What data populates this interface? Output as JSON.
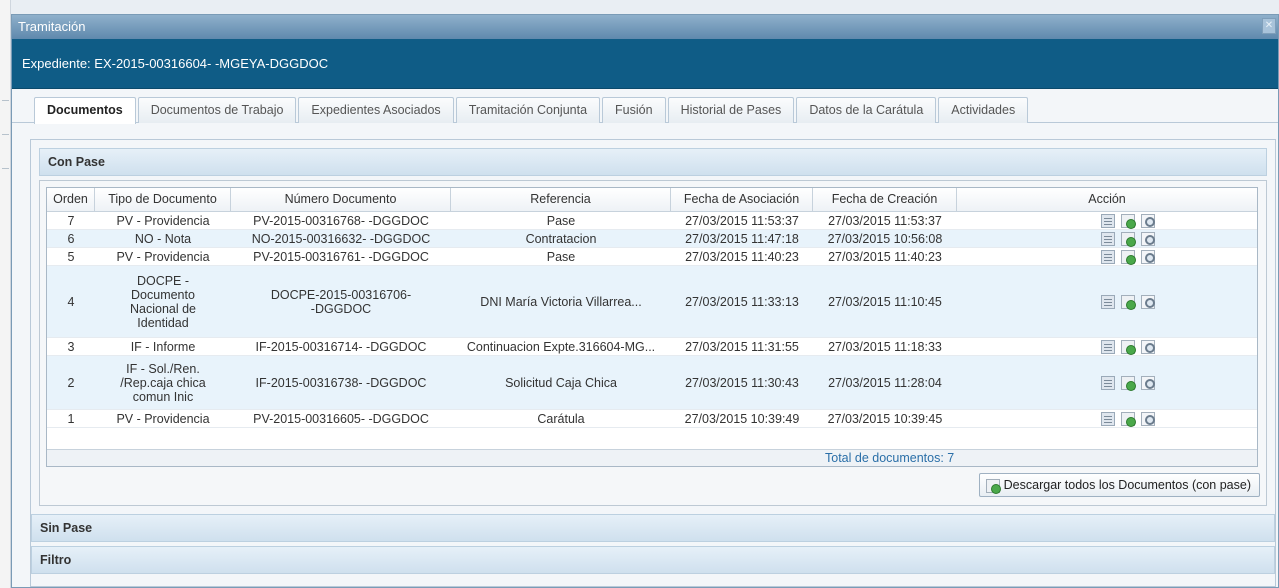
{
  "window": {
    "title": "Tramitación",
    "close_icon": "close-icon"
  },
  "expediente": {
    "label": "Expediente: EX-2015-00316604- -MGEYA-DGGDOC"
  },
  "tabs": [
    {
      "label": "Documentos",
      "active": true
    },
    {
      "label": "Documentos de Trabajo",
      "active": false
    },
    {
      "label": "Expedientes Asociados",
      "active": false
    },
    {
      "label": "Tramitación Conjunta",
      "active": false
    },
    {
      "label": "Fusión",
      "active": false
    },
    {
      "label": "Historial de Pases",
      "active": false
    },
    {
      "label": "Datos de la Carátula",
      "active": false
    },
    {
      "label": "Actividades",
      "active": false
    }
  ],
  "con_pase": {
    "title": "Con Pase",
    "columns": [
      "Orden",
      "Tipo de Documento",
      "Número Documento",
      "Referencia",
      "Fecha de Asociación",
      "Fecha de Creación",
      "Acción"
    ],
    "rows": [
      {
        "orden": "7",
        "tipo": "PV - Providencia",
        "numero": "PV-2015-00316768- -DGGDOC",
        "referencia": "Pase",
        "fecha_asoc": "27/03/2015 11:53:37",
        "fecha_creacion": "27/03/2015 11:53:37"
      },
      {
        "orden": "6",
        "tipo": "NO - Nota",
        "numero": "NO-2015-00316632- -DGGDOC",
        "referencia": "Contratacion",
        "fecha_asoc": "27/03/2015 11:47:18",
        "fecha_creacion": "27/03/2015 10:56:08"
      },
      {
        "orden": "5",
        "tipo": "PV - Providencia",
        "numero": "PV-2015-00316761- -DGGDOC",
        "referencia": "Pase",
        "fecha_asoc": "27/03/2015 11:40:23",
        "fecha_creacion": "27/03/2015 11:40:23"
      },
      {
        "orden": "4",
        "tipo": "DOCPE -\nDocumento\nNacional de\nIdentidad",
        "numero": "DOCPE-2015-00316706-\n-DGGDOC",
        "referencia": "DNI María Victoria Villarrea...",
        "fecha_asoc": "27/03/2015 11:33:13",
        "fecha_creacion": "27/03/2015 11:10:45"
      },
      {
        "orden": "3",
        "tipo": "IF - Informe",
        "numero": "IF-2015-00316714- -DGGDOC",
        "referencia": "Continuacion Expte.316604-MG...",
        "fecha_asoc": "27/03/2015 11:31:55",
        "fecha_creacion": "27/03/2015 11:18:33"
      },
      {
        "orden": "2",
        "tipo": "IF - Sol./Ren.\n/Rep.caja chica\ncomun Inic",
        "numero": "IF-2015-00316738- -DGGDOC",
        "referencia": "Solicitud Caja Chica",
        "fecha_asoc": "27/03/2015 11:30:43",
        "fecha_creacion": "27/03/2015 11:28:04"
      },
      {
        "orden": "1",
        "tipo": "PV - Providencia",
        "numero": "PV-2015-00316605- -DGGDOC",
        "referencia": "Carátula",
        "fecha_asoc": "27/03/2015 10:39:49",
        "fecha_creacion": "27/03/2015 10:39:45"
      }
    ],
    "total_label": "Total de documentos: 7",
    "download_all_label": "Descargar todos los Documentos (con pase)"
  },
  "sin_pase": {
    "title": "Sin Pase"
  },
  "filtro": {
    "title": "Filtro"
  }
}
